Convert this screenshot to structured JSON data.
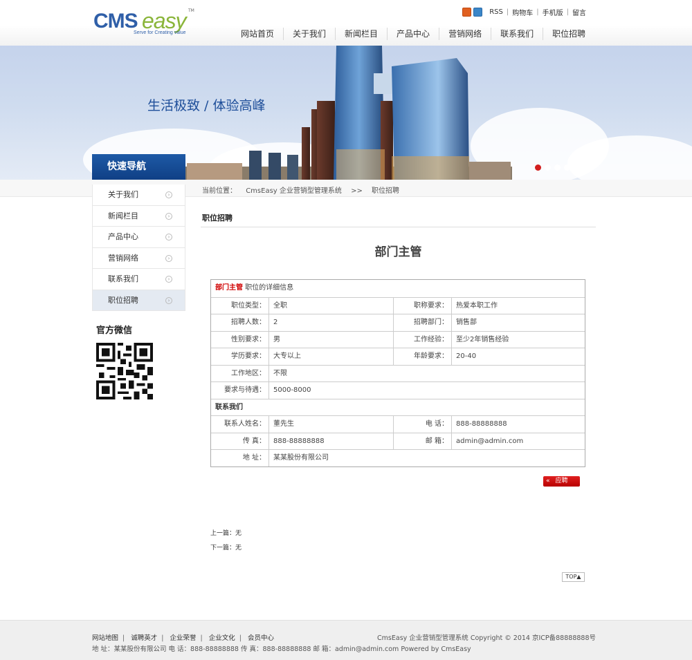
{
  "header": {
    "logo": {
      "cms": "CMS",
      "easy": "easy",
      "tm": "TM",
      "tagline": "Serve for Creating value"
    },
    "toplinks": [
      "RSS",
      "购物车",
      "手机版",
      "留言"
    ],
    "nav": [
      "网站首页",
      "关于我们",
      "新闻栏目",
      "产品中心",
      "营销网络",
      "联系我们",
      "职位招聘"
    ]
  },
  "banner": {
    "slogan": "生活极致 / 体验高峰",
    "slides": 5,
    "active_slide": 1
  },
  "breadcrumb": {
    "label": "当前位置：",
    "home": "CmsEasy 企业营销型管理系统",
    "sep": ">>",
    "current": "职位招聘"
  },
  "sidebar": {
    "title": "快速导航",
    "items": [
      "关于我们",
      "新闻栏目",
      "产品中心",
      "营销网络",
      "联系我们",
      "职位招聘"
    ],
    "active_index": 5,
    "wechat_title": "官方微信"
  },
  "main": {
    "section_title": "职位招聘",
    "job_title": "部门主管",
    "table": {
      "head_red": "部门主管",
      "head_text": "职位的详细信息",
      "rows": [
        {
          "l1": "职位类型：",
          "v1": "全职",
          "l2": "职称要求：",
          "v2": "热爱本职工作"
        },
        {
          "l1": "招聘人数：",
          "v1": "2",
          "l2": "招聘部门：",
          "v2": "销售部"
        },
        {
          "l1": "性别要求：",
          "v1": "男",
          "l2": "工作经验：",
          "v2": "至少2年销售经验"
        },
        {
          "l1": "学历要求：",
          "v1": "大专以上",
          "l2": "年龄要求：",
          "v2": "20-40"
        }
      ],
      "area_label": "工作地区：",
      "area_value": "不限",
      "salary_label": "要求与待遇：",
      "salary_value": "5000-8000",
      "contact_head": "联系我们",
      "contact_rows": [
        {
          "l1": "联系人姓名：",
          "v1": "董先生",
          "l2": "电 话：",
          "v2": "888-88888888"
        },
        {
          "l1": "传 真：",
          "v1": "888-88888888",
          "l2": "邮 箱：",
          "v2": "admin@admin.com"
        }
      ],
      "address_label": "地 址：",
      "address_value": "某某股份有限公司"
    },
    "apply_label": "应聘",
    "apply_arrow": "«",
    "prev": "上一篇：无",
    "next": "下一篇：无",
    "top_label": "TOP▲"
  },
  "footer": {
    "links": [
      "网站地图",
      "诚聘英才",
      "企业荣誉",
      "企业文化",
      "会员中心"
    ],
    "link_sep": "|",
    "copyright": "CmsEasy 企业营销型管理系统  Copyright © 2014  京ICP备88888888号",
    "info": "地 址：某某股份有限公司  电 话：888-88888888  传 真：888-88888888  邮 箱：admin@admin.com  Powered by CmsEasy"
  }
}
